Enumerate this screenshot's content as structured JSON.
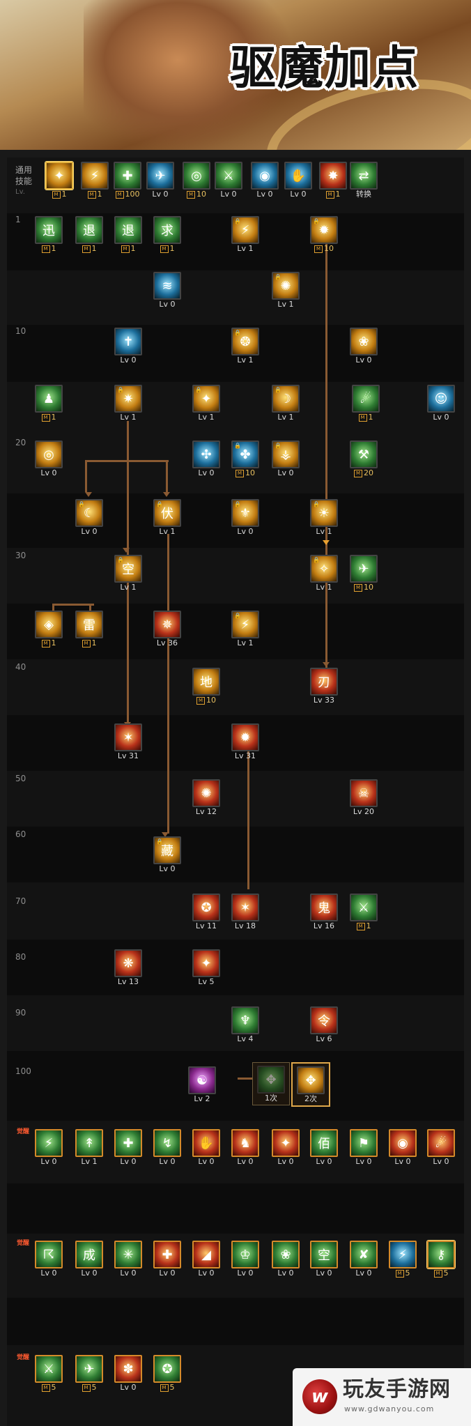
{
  "banner": {
    "title": "驱魔加点"
  },
  "common": {
    "label": "通用\n技能",
    "lv_glyph": "Lv."
  },
  "levels": [
    "1",
    "10",
    "20",
    "30",
    "40",
    "50",
    "60",
    "70",
    "80",
    "90",
    "100"
  ],
  "common_skills": [
    {
      "cap": "1",
      "m": true,
      "color": "gold",
      "glyph": "✦",
      "sel": true
    },
    {
      "cap": "1",
      "m": true,
      "color": "gold",
      "glyph": "⚡"
    },
    {
      "cap": "100",
      "m": true,
      "color": "green",
      "glyph": "✚"
    },
    {
      "cap": "Lv 0",
      "color": "blue",
      "glyph": "✈"
    },
    {
      "cap": "10",
      "m": true,
      "color": "green",
      "glyph": "◎"
    },
    {
      "cap": "Lv 0",
      "color": "green",
      "glyph": "⚔"
    },
    {
      "cap": "Lv 0",
      "color": "blue",
      "glyph": "◉"
    },
    {
      "cap": "Lv 0",
      "color": "blue",
      "glyph": "✋"
    },
    {
      "cap": "1",
      "m": true,
      "color": "red",
      "glyph": "✸"
    },
    {
      "cap": "转换",
      "color": "green",
      "glyph": "⇄"
    }
  ],
  "tree_skills": [
    {
      "cap": "1",
      "m": true,
      "color": "green",
      "glyph": "迅"
    },
    {
      "cap": "1",
      "m": true,
      "color": "green",
      "glyph": "退"
    },
    {
      "cap": "1",
      "m": true,
      "color": "green",
      "glyph": "退"
    },
    {
      "cap": "1",
      "m": true,
      "color": "green",
      "glyph": "求"
    },
    {
      "cap": "Lv 1",
      "color": "gold",
      "glyph": "⚡",
      "lock": true
    },
    {
      "cap": "10",
      "m": true,
      "color": "gold",
      "glyph": "✹",
      "lock": true
    },
    {
      "cap": "Lv 0",
      "color": "blue",
      "glyph": "≋"
    },
    {
      "cap": "Lv 1",
      "color": "gold",
      "glyph": "✺",
      "lock": true
    },
    {
      "cap": "Lv 0",
      "color": "blue",
      "glyph": "✝"
    },
    {
      "cap": "Lv 1",
      "color": "gold",
      "glyph": "❂",
      "lock": true
    },
    {
      "cap": "Lv 0",
      "color": "gold",
      "glyph": "❀"
    },
    {
      "cap": "1",
      "m": true,
      "color": "green",
      "glyph": "♟"
    },
    {
      "cap": "Lv 1",
      "color": "gold",
      "glyph": "✷",
      "lock": true
    },
    {
      "cap": "Lv 1",
      "color": "gold",
      "glyph": "✦",
      "lock": true
    },
    {
      "cap": "Lv 1",
      "color": "gold",
      "glyph": "☽",
      "lock": true
    },
    {
      "cap": "1",
      "m": true,
      "color": "green",
      "glyph": "☄"
    },
    {
      "cap": "Lv 0",
      "color": "blue",
      "glyph": "☺"
    },
    {
      "cap": "Lv 0",
      "color": "gold",
      "glyph": "◎"
    },
    {
      "cap": "Lv 0",
      "color": "blue",
      "glyph": "✣"
    },
    {
      "cap": "10",
      "m": true,
      "color": "blue",
      "glyph": "✤",
      "lock": true
    },
    {
      "cap": "Lv 0",
      "color": "gold",
      "glyph": "⚶",
      "lock": true
    },
    {
      "cap": "20",
      "m": true,
      "color": "green",
      "glyph": "⚒"
    },
    {
      "cap": "Lv 0",
      "color": "gold",
      "glyph": "☾",
      "lock": true
    },
    {
      "cap": "Lv 1",
      "color": "gold",
      "glyph": "伏",
      "lock": true
    },
    {
      "cap": "Lv 0",
      "color": "gold",
      "glyph": "⚜",
      "lock": true
    },
    {
      "cap": "Lv 1",
      "color": "gold",
      "glyph": "☀",
      "lock": true
    },
    {
      "cap": "Lv 1",
      "color": "gold",
      "glyph": "空",
      "lock": true
    },
    {
      "cap": "Lv 1",
      "color": "gold",
      "glyph": "✧",
      "lock": true
    },
    {
      "cap": "10",
      "m": true,
      "color": "green",
      "glyph": "✈"
    },
    {
      "cap": "1",
      "m": true,
      "color": "gold",
      "glyph": "◈"
    },
    {
      "cap": "1",
      "m": true,
      "color": "gold",
      "glyph": "雷"
    },
    {
      "cap": "Lv 36",
      "color": "red",
      "glyph": "✵"
    },
    {
      "cap": "Lv 1",
      "color": "gold",
      "glyph": "⚡",
      "lock": true
    },
    {
      "cap": "10",
      "m": true,
      "color": "gold",
      "glyph": "地"
    },
    {
      "cap": "Lv 33",
      "color": "red",
      "glyph": "刃"
    },
    {
      "cap": "Lv 31",
      "color": "red",
      "glyph": "✶"
    },
    {
      "cap": "Lv 31",
      "color": "red",
      "glyph": "✹"
    },
    {
      "cap": "Lv 12",
      "color": "red",
      "glyph": "✺"
    },
    {
      "cap": "Lv 20",
      "color": "red",
      "glyph": "☠"
    },
    {
      "cap": "Lv 0",
      "color": "gold",
      "glyph": "藏",
      "lock": true
    },
    {
      "cap": "Lv 11",
      "color": "red",
      "glyph": "✪"
    },
    {
      "cap": "Lv 18",
      "color": "red",
      "glyph": "✶"
    },
    {
      "cap": "Lv 16",
      "color": "red",
      "glyph": "鬼"
    },
    {
      "cap": "1",
      "m": true,
      "color": "green",
      "glyph": "⚔"
    },
    {
      "cap": "Lv 13",
      "color": "red",
      "glyph": "❋"
    },
    {
      "cap": "Lv 5",
      "color": "red",
      "glyph": "✦"
    },
    {
      "cap": "Lv 4",
      "color": "green",
      "glyph": "♆"
    },
    {
      "cap": "Lv 6",
      "color": "red",
      "glyph": "令"
    },
    {
      "cap": "Lv 2",
      "color": "purple",
      "glyph": "☯"
    }
  ],
  "evolutions": [
    {
      "cap": "1次"
    },
    {
      "cap": "2次"
    }
  ],
  "awaken_tag": "觉醒",
  "passive_rows": [
    [
      {
        "cap": "Lv 0",
        "color": "green",
        "glyph": "⚡"
      },
      {
        "cap": "Lv 1",
        "color": "green",
        "glyph": "↟"
      },
      {
        "cap": "Lv 0",
        "color": "green",
        "glyph": "✚"
      },
      {
        "cap": "Lv 0",
        "color": "green",
        "glyph": "↯"
      },
      {
        "cap": "Lv 0",
        "color": "red",
        "glyph": "✋"
      },
      {
        "cap": "Lv 0",
        "color": "red",
        "glyph": "♞"
      },
      {
        "cap": "Lv 0",
        "color": "red",
        "glyph": "✦"
      },
      {
        "cap": "Lv 0",
        "color": "green",
        "glyph": "佰"
      },
      {
        "cap": "Lv 0",
        "color": "green",
        "glyph": "⚑"
      },
      {
        "cap": "Lv 0",
        "color": "red",
        "glyph": "◉"
      },
      {
        "cap": "Lv 0",
        "color": "red",
        "glyph": "☄"
      }
    ],
    [
      {
        "cap": "Lv 0",
        "color": "green",
        "glyph": "☈"
      },
      {
        "cap": "Lv 0",
        "color": "green",
        "glyph": "成"
      },
      {
        "cap": "Lv 0",
        "color": "green",
        "glyph": "✳"
      },
      {
        "cap": "Lv 0",
        "color": "red",
        "glyph": "✚"
      },
      {
        "cap": "Lv 0",
        "color": "red",
        "glyph": "◢"
      },
      {
        "cap": "Lv 0",
        "color": "green",
        "glyph": "♔"
      },
      {
        "cap": "Lv 0",
        "color": "green",
        "glyph": "❀"
      },
      {
        "cap": "Lv 0",
        "color": "green",
        "glyph": "空"
      },
      {
        "cap": "Lv 0",
        "color": "green",
        "glyph": "✘"
      },
      {
        "cap": "5",
        "m": true,
        "color": "blue",
        "glyph": "⚡"
      },
      {
        "cap": "5",
        "m": true,
        "color": "green",
        "glyph": "⚷",
        "sel": true
      }
    ],
    [
      {
        "cap": "5",
        "m": true,
        "color": "green",
        "glyph": "⚔"
      },
      {
        "cap": "5",
        "m": true,
        "color": "green",
        "glyph": "✈"
      },
      {
        "cap": "Lv 0",
        "color": "red",
        "glyph": "✽"
      },
      {
        "cap": "5",
        "m": true,
        "color": "green",
        "glyph": "✪"
      }
    ]
  ],
  "watermark": {
    "logo": "w",
    "name": "玩友手游网",
    "url": "www.gdwanyou.com"
  }
}
